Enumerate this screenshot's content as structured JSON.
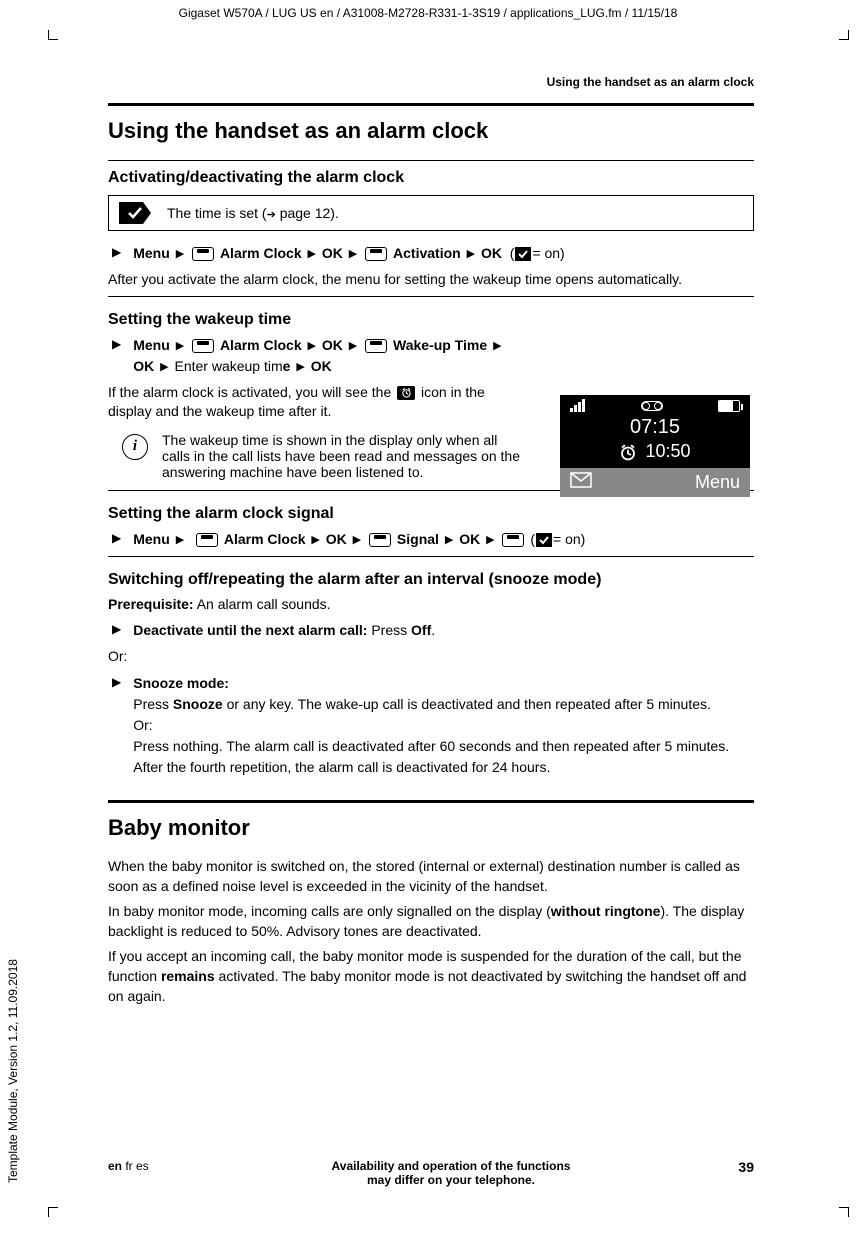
{
  "doc_header": "Gigaset W570A / LUG US en / A31008-M2728-R331-1-3S19 / applications_LUG.fm / 11/15/18",
  "left_vertical": "Template Module, Version 1.2, 11.09.2018",
  "page_header": "Using the handset as an alarm clock",
  "h1_alarm": "Using the handset as an alarm clock",
  "h2_activate": "Activating/deactivating the alarm clock",
  "note_time_set_prefix": "The time is set (",
  "note_time_set_page": " page 12).",
  "step_menu": "Menu",
  "step_alarm_clock": "Alarm  Clock",
  "step_ok": "OK",
  "step_activation": "Activation",
  "eq_on": "= on)",
  "after_activate": "After you activate the alarm clock, the menu for setting the wakeup time opens automatically.",
  "h2_wakeup": "Setting the wakeup time",
  "step_wakeup_time": "Wake-up  Time",
  "enter_wakeup": " Enter wakeup tim",
  "enter_wakeup_e": "e",
  "if_active_prefix": "If the alarm clock is activated, you will see the ",
  "if_active_suffix": " icon in the display and the wakeup time after it.",
  "info_wakeup_shown": "The wakeup time is shown in the display only when all calls in the call lists have been read and messages on the answering machine have been listened to.",
  "h2_signal": "Setting the alarm clock signal",
  "step_signal": "Signal",
  "h2_snooze": "Switching off/repeating the alarm after an interval (snooze mode)",
  "prereq_label": "Prerequisite:",
  "prereq_text": " An alarm call sounds.",
  "deactivate_label": "Deactivate until the next alarm call:",
  "deactivate_text": " Press ",
  "off_label": "Off",
  "or_text": "Or:",
  "snooze_label": "Snooze mode:",
  "snooze_press": "Press ",
  "snooze_word": "Snooze",
  "snooze_rest": " or any key. The wake-up call is deactivated and then repeated after 5 minutes.",
  "snooze_or": "Or:",
  "snooze_nothing": "Press nothing. The alarm call is deactivated after 60 seconds and then repeated after 5 minutes. After the fourth repetition, the alarm call is deactivated for 24 hours.",
  "h1_baby": "Baby monitor",
  "baby_p1": "When the baby monitor is switched on, the stored (internal or external) destination number is called as soon as a defined noise level is exceeded in the vicinity of the handset.",
  "baby_p2_a": "In baby monitor mode, incoming calls are only signalled on the display (",
  "baby_p2_bold": "without ringtone",
  "baby_p2_b": "). The display backlight is reduced to 50%. Advisory tones are deactivated.",
  "baby_p3_a": "If you accept an incoming call, the baby monitor mode is suspended for the duration of the call, but the function ",
  "baby_p3_bold": "remains",
  "baby_p3_b": " activated. The baby monitor mode is not deactivated by switching the handset off and on again.",
  "footer_lang_bold": "en",
  "footer_lang_rest": " fr es",
  "footer_center_l1": "Availability and operation of the functions",
  "footer_center_l2": "may differ on your telephone.",
  "footer_page": "39",
  "display": {
    "time": "07:15",
    "alarm_time": "10:50",
    "menu_label": "Menu"
  }
}
